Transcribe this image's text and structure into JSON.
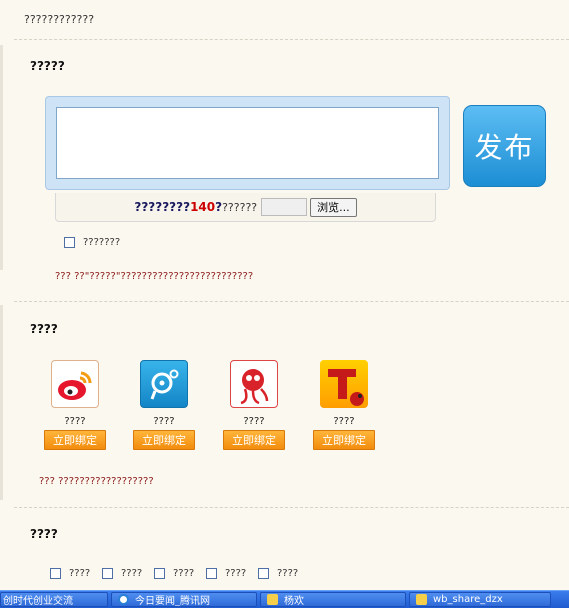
{
  "top_text": "????????????",
  "compose": {
    "title": "?????",
    "textarea_value": "",
    "publish_label": "发布",
    "hint_prefix": "????????",
    "char_limit": "140",
    "hint_suffix": "??????",
    "browse_label": "浏览...",
    "sync_checkbox_label": "???????",
    "note": "??? ??\"?????\"?????????????????????????"
  },
  "accounts": {
    "title": "????",
    "items": [
      {
        "icon": "sina-weibo-icon",
        "name": "????",
        "bind_label": "立即绑定"
      },
      {
        "icon": "tencent-weibo-icon",
        "name": "????",
        "bind_label": "立即绑定"
      },
      {
        "icon": "netease-weibo-icon",
        "name": "????",
        "bind_label": "立即绑定"
      },
      {
        "icon": "sohu-weibo-icon",
        "name": "????",
        "bind_label": "立即绑定"
      }
    ],
    "note": "??? ??????????????????"
  },
  "share": {
    "title": "????",
    "options": [
      "????",
      "????",
      "????",
      "????",
      "????"
    ]
  },
  "taskbar": {
    "items": [
      {
        "label": "创时代创业交流",
        "icon": "ie-icon"
      },
      {
        "label": "今日要闻_腾讯网",
        "icon": "ie-icon"
      },
      {
        "label": "杨欢",
        "icon": "folder-icon"
      },
      {
        "label": "wb_share_dzx",
        "icon": "folder-icon"
      }
    ]
  }
}
